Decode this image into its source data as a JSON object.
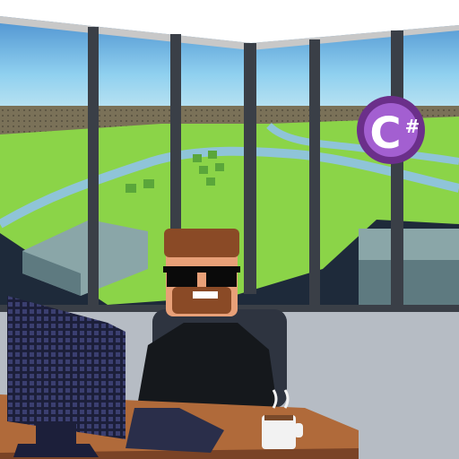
{
  "scene": {
    "badge": {
      "letter": "C",
      "symbol": "#",
      "icon": "csharp-logo-icon"
    }
  },
  "colors": {
    "sky_top": "#3a7fc7",
    "sky_mid": "#8fd0ef",
    "sky_horizon": "#d8f0f4",
    "ceiling": "#ffffff",
    "ceiling_shadow": "#c8c8c8",
    "window_frame": "#3a3f47",
    "window_frame_light": "#5b6470",
    "grass": "#8bd448",
    "grass_dark": "#5aa63a",
    "river": "#8fc4d8",
    "field_far": "#7a7158",
    "building": "#8aa6a8",
    "building_dark": "#5e7a80",
    "floor": "#b6bcc4",
    "desk": "#b06a3a",
    "desk_dark": "#7a4326",
    "monitor": "#1c1f3a",
    "monitor_grid": "#3b3f70",
    "shirt": "#15181c",
    "skin": "#e8a078",
    "hair": "#8a4a26",
    "glasses": "#0a0a0a",
    "chair": "#2e3440",
    "mug": "#f2f2f2",
    "coffee": "#7a4a2a",
    "badge_outer": "#6b2f8a",
    "badge_inner": "#a35fd1",
    "badge_text": "#ffffff"
  }
}
